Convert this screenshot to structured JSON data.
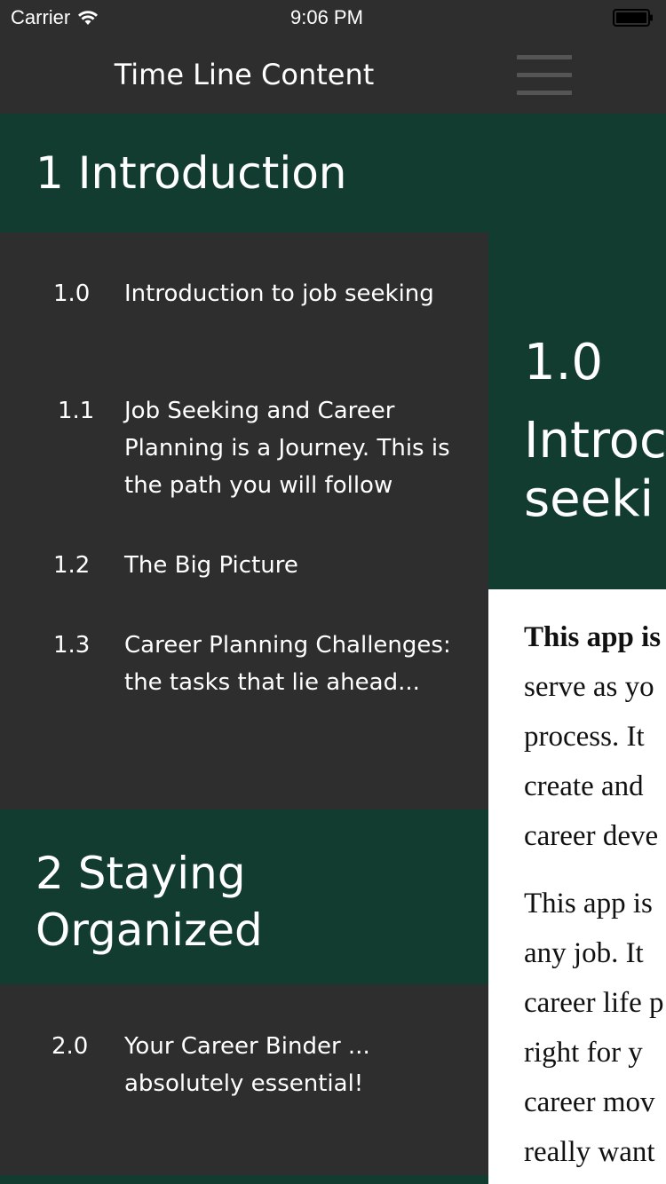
{
  "status_bar": {
    "carrier": "Carrier",
    "time": "9:06 PM"
  },
  "sidebar": {
    "title": "Time Line Content",
    "sections": [
      {
        "header": "1 Introduction",
        "items": [
          {
            "num": "1.0",
            "title": "Introduction to job seeking"
          },
          {
            "num": "1.1",
            "title": "Job Seeking and Career Planning is a Journey. This is the path you will follow"
          },
          {
            "num": "1.2",
            "title": "The Big Picture"
          },
          {
            "num": "1.3",
            "title": "Career Planning Challenges: the tasks that lie ahead..."
          }
        ]
      },
      {
        "header": "2 Staying Organized",
        "items": [
          {
            "num": "2.0",
            "title": "Your Career Binder ... absolutely essential!"
          }
        ]
      }
    ]
  },
  "content": {
    "hero_number": "1.0",
    "hero_heading_line1": "Introc",
    "hero_heading_line2": "seeki",
    "body": {
      "p1_bold": "This app is",
      "p1_lines": [
        "serve  as  yo",
        "process.  It",
        "create  and",
        "career deve"
      ],
      "p2_lines": [
        "This app is",
        "any  job.  It",
        "career life p",
        "right  for  y",
        "career  mov",
        "really  want"
      ]
    }
  },
  "colors": {
    "sidebar_bg": "#2e2e2e",
    "section_header_bg": "#133c31",
    "text_light": "#ffffff",
    "body_text": "#111111"
  }
}
